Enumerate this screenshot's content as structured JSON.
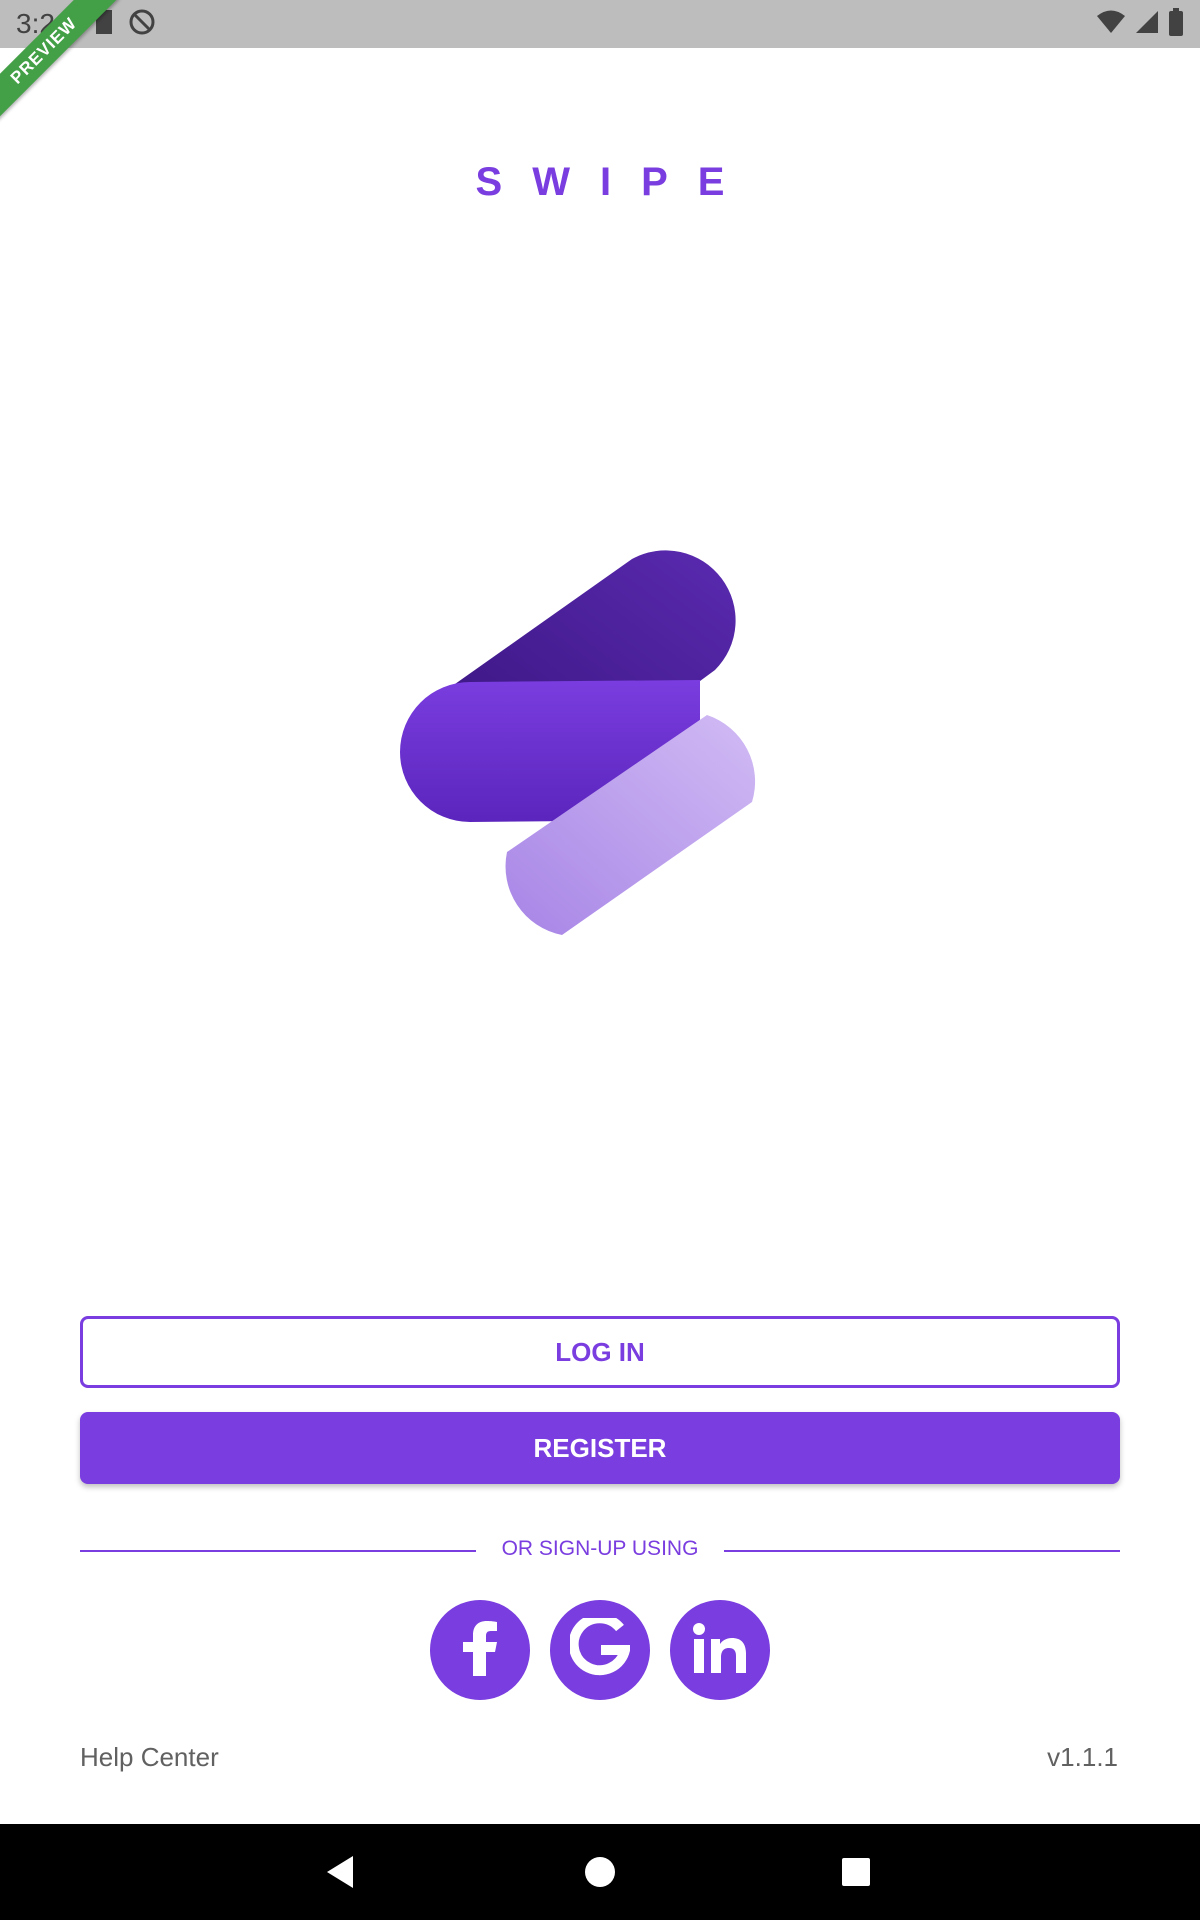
{
  "status_bar": {
    "time": "3:24",
    "left_icons": [
      "sd-card-icon",
      "no-sync-icon"
    ],
    "right_icons": [
      "wifi-icon",
      "cell-signal-icon",
      "battery-icon"
    ]
  },
  "ribbon": {
    "label": "PREVIEW",
    "color": "#43a047"
  },
  "app": {
    "title": "SWIPE"
  },
  "logo": {
    "icon": "swipe-logo-icon",
    "colors": [
      "#4a1f9a",
      "#5b28c0",
      "#c9b0f0"
    ]
  },
  "actions": {
    "login_label": "LOG IN",
    "register_label": "REGISTER"
  },
  "divider": {
    "label": "OR SIGN-UP USING"
  },
  "social": [
    {
      "name": "facebook",
      "icon": "facebook-icon"
    },
    {
      "name": "google",
      "icon": "google-icon"
    },
    {
      "name": "linkedin",
      "icon": "linkedin-icon"
    }
  ],
  "footer": {
    "help_label": "Help Center",
    "version": "v1.1.1"
  },
  "nav": {
    "icons": [
      "back-icon",
      "home-icon",
      "recents-icon"
    ]
  },
  "theme": {
    "accent": "#7a3ddf"
  }
}
